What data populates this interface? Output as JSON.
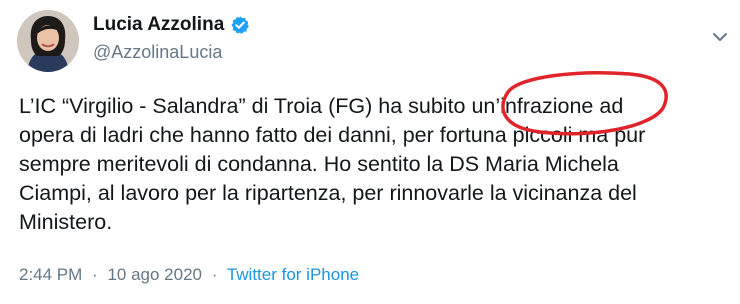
{
  "author": {
    "display_name": "Lucia Azzolina",
    "handle": "@AzzolinaLucia",
    "verified_icon": "verified-badge-icon"
  },
  "tweet": {
    "text": "L’IC “Virgilio - Salandra” di Troia (FG) ha subito un’infrazione ad\nopera di ladri che hanno fatto dei danni, per fortuna piccoli ma pur\nsempre meritevoli di condanna. Ho sentito la DS Maria Michela\nCiampi, al lavoro per la ripartenza, per rinnovarle la vicinanza del\nMinistero.",
    "time": "2:44 PM",
    "separator": "·",
    "date": "10 ago 2020",
    "source": "Twitter for iPhone"
  },
  "colors": {
    "accent": "#1da1f2",
    "annotation": "#e0242a",
    "secondary_text": "#657786",
    "link": "#1b95e0"
  }
}
